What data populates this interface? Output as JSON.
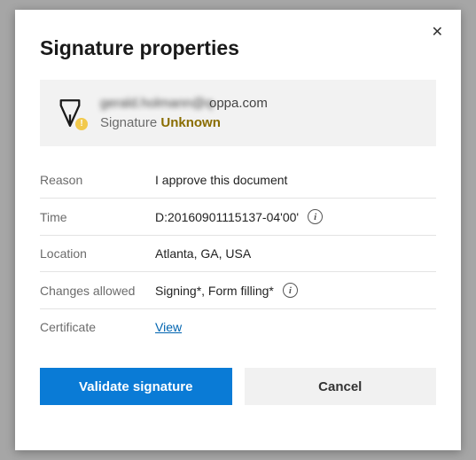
{
  "dialog": {
    "title": "Signature properties",
    "close_glyph": "✕"
  },
  "summary": {
    "signer_blurred": "gerald.holmann@q",
    "signer_clear": "oppa.com",
    "status_label": "Signature",
    "status_value": "Unknown",
    "badge": "!"
  },
  "rows": {
    "reason": {
      "label": "Reason",
      "value": "I approve this document"
    },
    "time": {
      "label": "Time",
      "value": "D:20160901115137-04'00'"
    },
    "location": {
      "label": "Location",
      "value": "Atlanta, GA, USA"
    },
    "changes": {
      "label": "Changes allowed",
      "value": "Signing*, Form filling*"
    },
    "cert": {
      "label": "Certificate",
      "link": "View"
    }
  },
  "actions": {
    "validate": "Validate signature",
    "cancel": "Cancel"
  }
}
